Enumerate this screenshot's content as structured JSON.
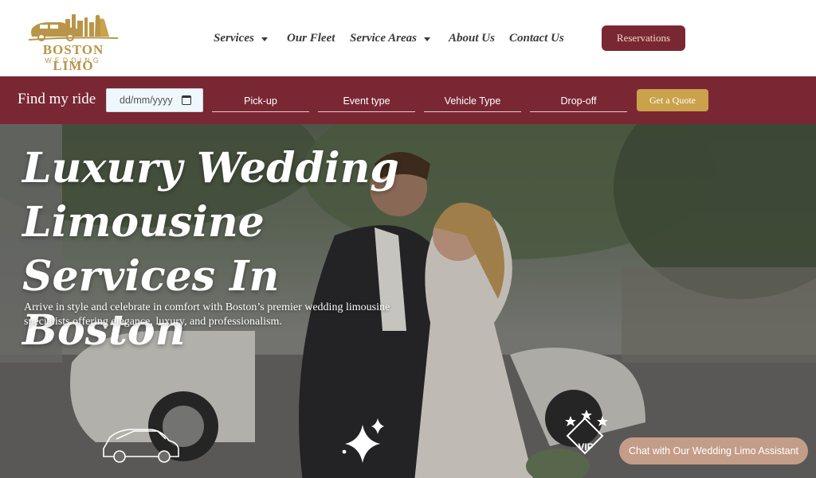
{
  "header": {
    "logo": {
      "name": "BOSTON LIMO",
      "sub": "WEDDING"
    },
    "nav": [
      {
        "label": "Services",
        "dropdown": true
      },
      {
        "label": "Our Fleet",
        "dropdown": false
      },
      {
        "label": "Service Areas",
        "dropdown": true
      },
      {
        "label": "About Us",
        "dropdown": false
      },
      {
        "label": "Contact Us",
        "dropdown": false
      }
    ],
    "reservations_label": "Reservations"
  },
  "findbar": {
    "title": "Find my ride",
    "date_placeholder": "dd/mm/yyyy",
    "fields": [
      "Pick-up",
      "Event type",
      "Vehicle Type",
      "Drop-off"
    ],
    "quote_label": "Get a Quote"
  },
  "hero": {
    "title_lines": [
      "Luxury Wedding",
      "Limousine",
      "Services In Boston"
    ],
    "subtitle": "Arrive in style and celebrate in comfort with Boston’s premier wedding limousine specialists offering elegance, luxury, and professionalism.",
    "vip_badge": "VIP"
  },
  "chat": {
    "label": "Chat with Our Wedding Limo Assistant"
  },
  "colors": {
    "brand": "#7a2734",
    "gold": "#c9a24b",
    "logo_gold": "#b89548",
    "chat": "#c39d88"
  },
  "icons": [
    "limo-logo-icon",
    "caret-down-icon",
    "calendar-icon",
    "car-icon",
    "sparkle-icon",
    "vip-badge-icon"
  ]
}
